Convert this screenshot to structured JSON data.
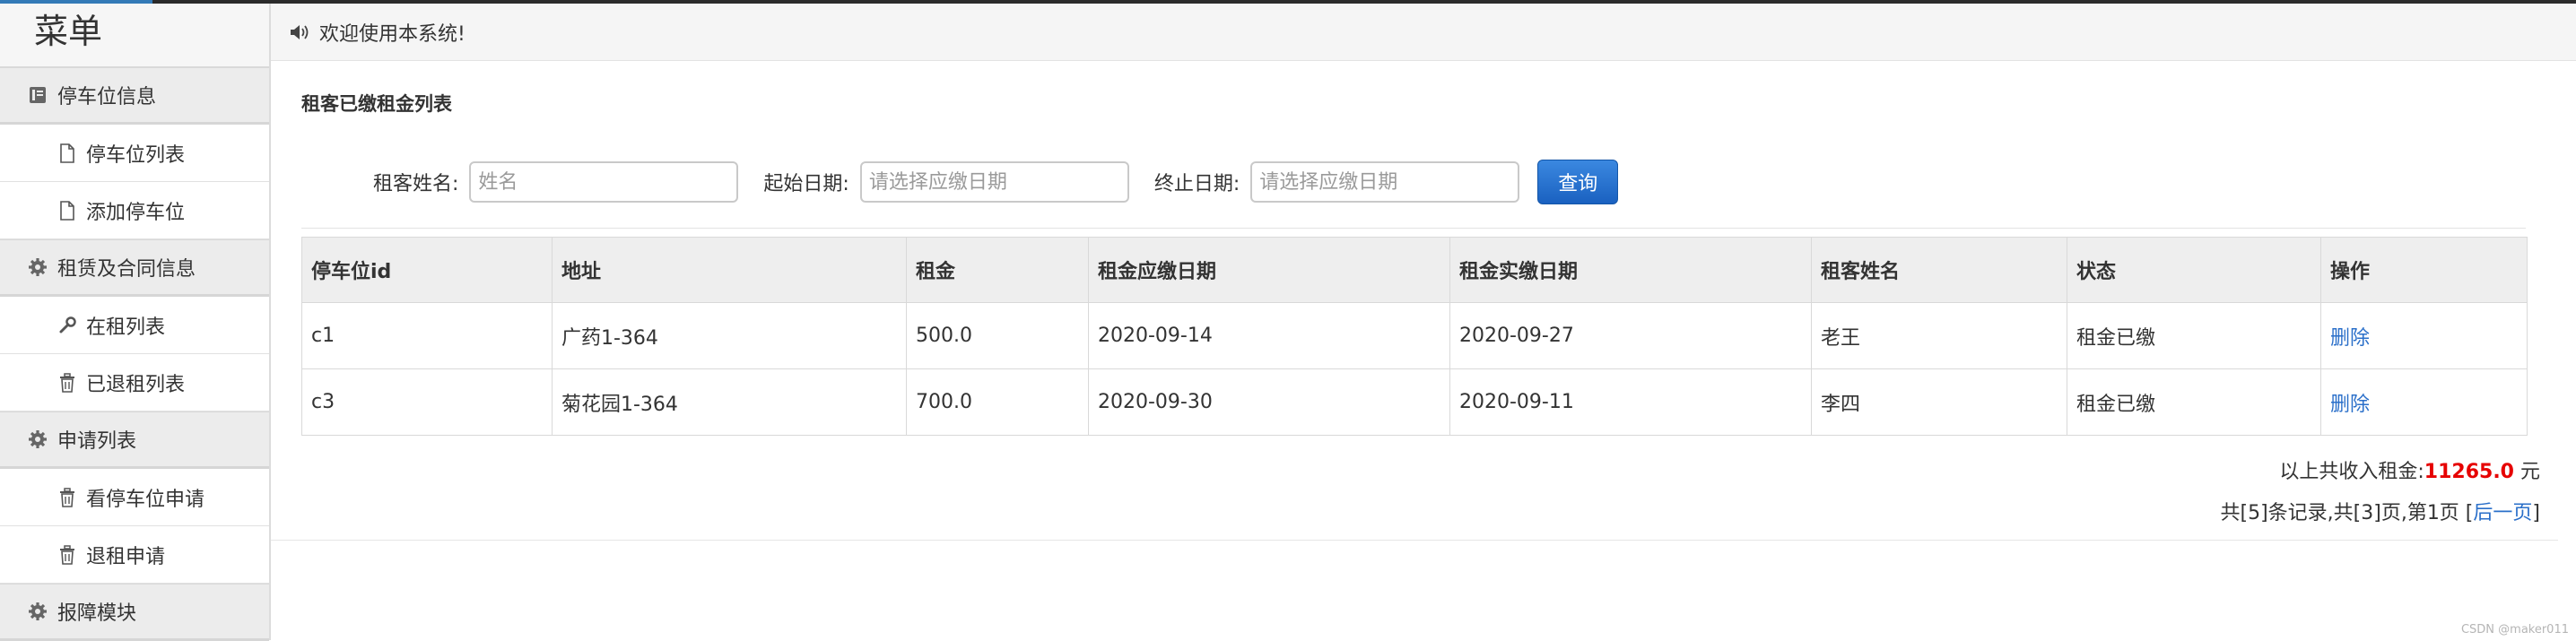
{
  "sidebar": {
    "title": "菜单",
    "groups": [
      {
        "label": "停车位信息",
        "icon": "book-icon",
        "items": [
          {
            "label": "停车位列表",
            "icon": "file-icon"
          },
          {
            "label": "添加停车位",
            "icon": "file-icon"
          }
        ]
      },
      {
        "label": "租赁及合同信息",
        "icon": "gear-icon",
        "items": [
          {
            "label": "在租列表",
            "icon": "wrench-icon"
          },
          {
            "label": "已退租列表",
            "icon": "trash-icon"
          }
        ]
      },
      {
        "label": "申请列表",
        "icon": "gear-icon",
        "items": [
          {
            "label": "看停车位申请",
            "icon": "trash-icon"
          },
          {
            "label": "退租申请",
            "icon": "trash-icon"
          }
        ]
      },
      {
        "label": "报障模块",
        "icon": "gear-icon",
        "items": []
      }
    ]
  },
  "header": {
    "welcome": "欢迎使用本系统!",
    "icon": "speaker-icon"
  },
  "main": {
    "title": "租客已缴租金列表",
    "search": {
      "name_label": "租客姓名:",
      "name_placeholder": "姓名",
      "name_value": "",
      "start_label": "起始日期:",
      "start_placeholder": "请选择应缴日期",
      "start_value": "",
      "end_label": "终止日期:",
      "end_placeholder": "请选择应缴日期",
      "end_value": "",
      "button": "查询"
    },
    "table": {
      "headers": [
        "停车位id",
        "地址",
        "租金",
        "租金应缴日期",
        "租金实缴日期",
        "租客姓名",
        "状态",
        "操作"
      ],
      "rows": [
        {
          "id": "c1",
          "address": "广药1-364",
          "rent": "500.0",
          "due_date": "2020-09-14",
          "paid_date": "2020-09-27",
          "tenant": "老王",
          "status": "租金已缴",
          "action": "删除"
        },
        {
          "id": "c3",
          "address": "菊花园1-364",
          "rent": "700.0",
          "due_date": "2020-09-30",
          "paid_date": "2020-09-11",
          "tenant": "李四",
          "status": "租金已缴",
          "action": "删除"
        }
      ]
    },
    "total": {
      "label": "以上共收入租金:",
      "amount": "11265.0",
      "unit": "元"
    },
    "pager": {
      "text": "共[5]条记录,共[3]页,第1页 [",
      "next": "后一页",
      "close": "]"
    }
  },
  "watermark": "CSDN @maker011",
  "colors": {
    "accent": "#1f6fd1",
    "link": "#2a6fc9",
    "total_amount": "#e60000"
  }
}
